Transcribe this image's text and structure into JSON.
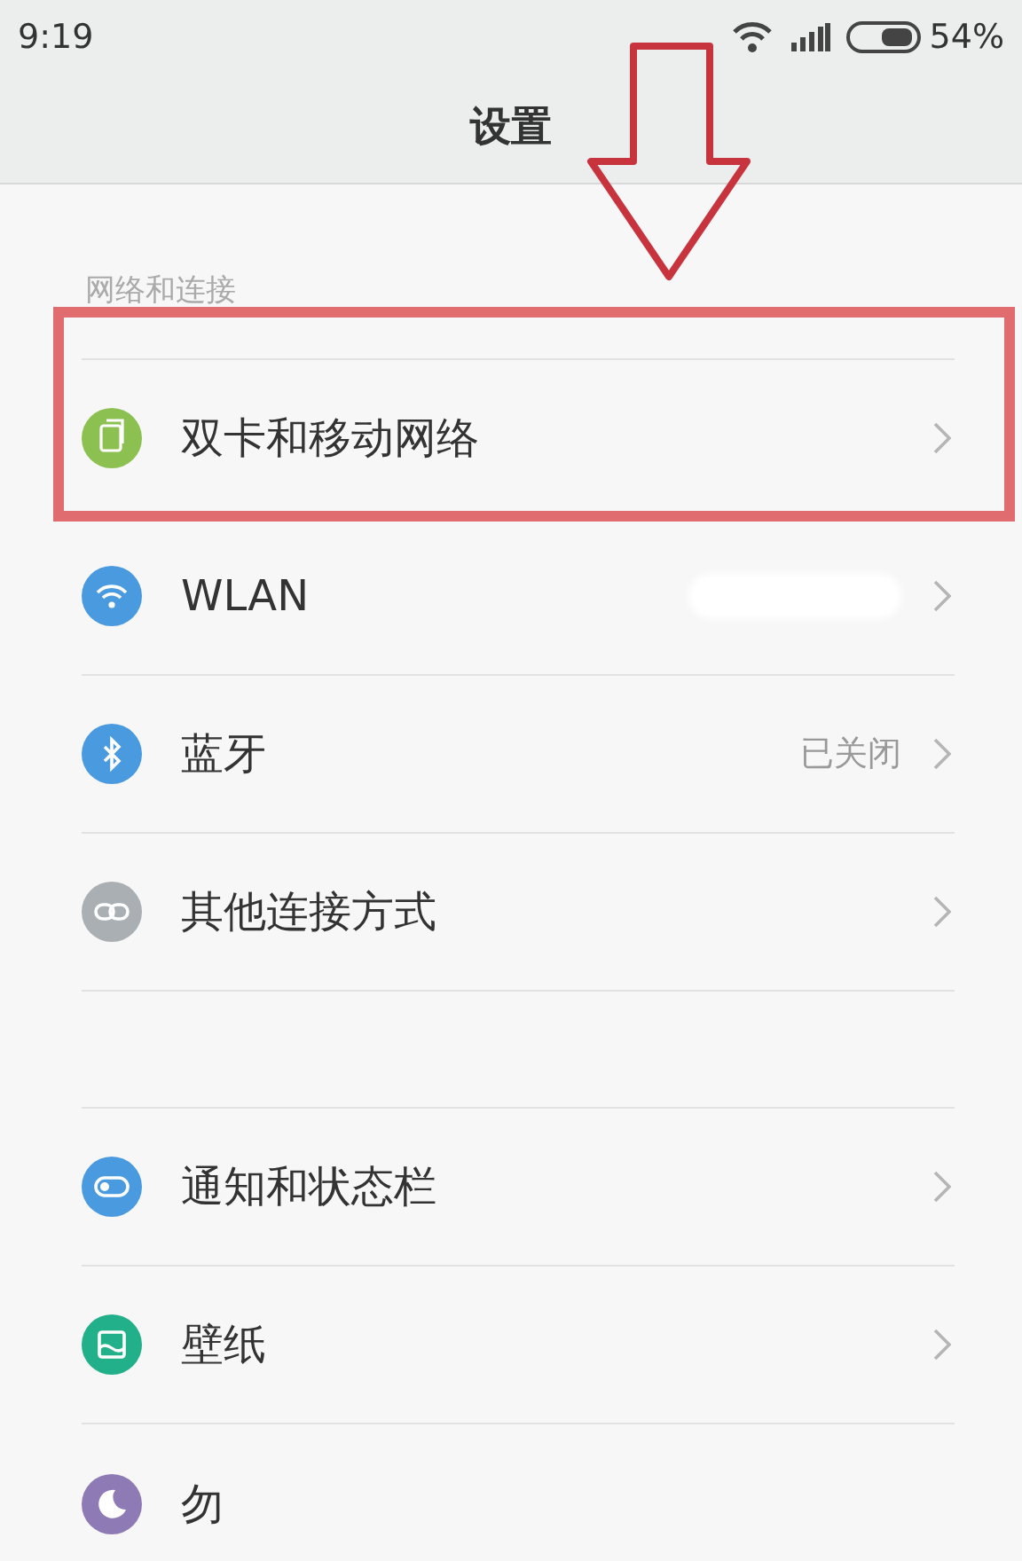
{
  "status_bar": {
    "time": "9:19",
    "battery": "54%"
  },
  "title": "设置",
  "sections": [
    {
      "header": "网络和连接",
      "items": [
        {
          "kind": "sim",
          "color": "#8cc152",
          "label": "双卡和移动网络",
          "highlighted": true
        },
        {
          "kind": "wifi",
          "color": "#4a9ae0",
          "label": "WLAN",
          "redacted": true
        },
        {
          "kind": "bluetooth",
          "color": "#4a9ae0",
          "label": "蓝牙",
          "value": "已关闭"
        },
        {
          "kind": "link",
          "color": "#a9afb3",
          "label": "其他连接方式"
        }
      ]
    },
    {
      "items": [
        {
          "kind": "toggle",
          "color": "#4a9ae0",
          "label": "通知和状态栏"
        },
        {
          "kind": "wallpaper",
          "color": "#22b08a",
          "label": "壁纸"
        },
        {
          "kind": "moon",
          "color": "#8e7bb5",
          "label": "勿",
          "cut": true
        }
      ]
    }
  ],
  "annotation": {
    "kind": "arrow"
  }
}
